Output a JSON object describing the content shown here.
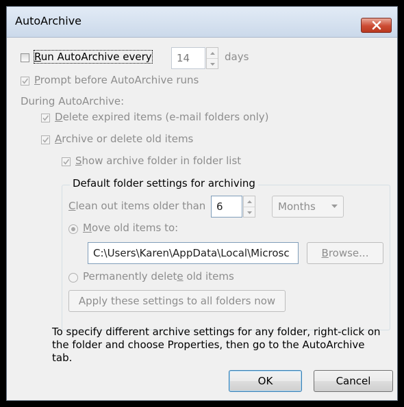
{
  "window": {
    "title": "AutoArchive",
    "close_icon": "close-icon"
  },
  "run_every": {
    "label_pre": "",
    "label_accel": "R",
    "label_rest": "un AutoArchive every",
    "checked": false,
    "value": "14",
    "units": "days"
  },
  "prompt": {
    "accel": "P",
    "rest": "rompt before AutoArchive runs",
    "checked": true
  },
  "during_label": "During AutoArchive:",
  "delete_expired": {
    "accel": "D",
    "rest": "elete expired items (e-mail folders only)",
    "checked": true
  },
  "archive_old": {
    "accel": "A",
    "rest": "rchive or delete old items",
    "checked": true
  },
  "show_archive": {
    "accel": "S",
    "rest": "how archive folder in folder list",
    "checked": true
  },
  "group": {
    "legend": "Default folder settings for archiving",
    "clean_out": {
      "accel": "C",
      "rest": "lean out items older than",
      "value": "6",
      "period": "Months"
    },
    "move_old": {
      "accel": "M",
      "rest": "ove old items to:",
      "selected": true,
      "path": "C:\\Users\\Karen\\AppData\\Local\\Microsc"
    },
    "browse": {
      "accel": "B",
      "rest": "rowse..."
    },
    "perm_delete": {
      "pre": "Permanently delet",
      "accel": "e",
      "rest": " old items",
      "selected": false
    },
    "apply_label": "Apply these settings to all folders now"
  },
  "info_text": "To specify different archive settings for any folder, right-click on the folder and choose Properties, then go to the AutoArchive tab.",
  "buttons": {
    "ok": "OK",
    "cancel": "Cancel"
  },
  "colors": {
    "titlebar": "#cbd9ea",
    "close": "#cc4b33",
    "disabled_text": "#8d8d8d"
  }
}
